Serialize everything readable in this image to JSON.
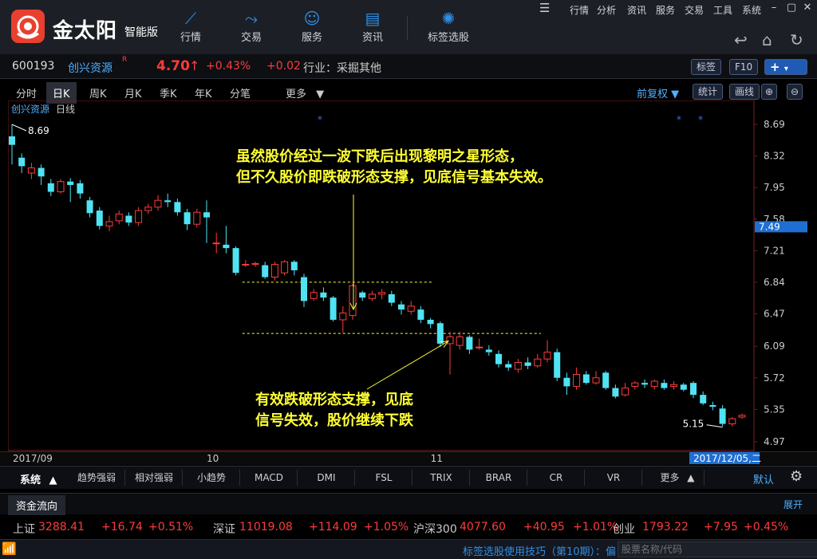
{
  "app": {
    "logo_text": "金太阳",
    "logo_sub": "智能版",
    "nav": [
      {
        "label": "行情",
        "icon": "trend-icon"
      },
      {
        "label": "交易",
        "icon": "trade-icon"
      },
      {
        "label": "服务",
        "icon": "user-icon"
      },
      {
        "label": "资讯",
        "icon": "news-icon"
      },
      {
        "label": "标签选股",
        "icon": "bulb-icon"
      }
    ],
    "menu": [
      "行情",
      "分析",
      "资讯",
      "服务",
      "交易",
      "工具",
      "系统"
    ]
  },
  "quote": {
    "code": "600193",
    "name": "创兴资源",
    "sup": "R",
    "price": "4.70",
    "arrow": "↑",
    "pct": "+0.43%",
    "chg": "+0.02",
    "industry": "行业：采掘其他",
    "btn_tag": "标签",
    "btn_f10": "F10",
    "btn_plus": "+"
  },
  "tabs": {
    "items": [
      "分时",
      "日K",
      "周K",
      "月K",
      "季K",
      "年K",
      "分笔"
    ],
    "active": 1,
    "more": "更多",
    "fq": "前复权",
    "stat": "统计",
    "draw": "画线"
  },
  "chart_data": {
    "type": "candlestick",
    "title": "创兴资源",
    "subtitle": "日线",
    "ylim": [
      4.9,
      8.8
    ],
    "yticks": [
      "8.69",
      "8.32",
      "7.95",
      "7.58",
      "7.21",
      "6.84",
      "6.47",
      "6.09",
      "5.72",
      "5.35",
      "4.97"
    ],
    "current_label": "7.49",
    "high_label": "8.69",
    "low_label": "5.15",
    "x_labels": [
      {
        "text": "2017/09",
        "i": 0
      },
      {
        "text": "10",
        "i": 20
      },
      {
        "text": "11",
        "i": 43
      },
      {
        "text": "2017/12/05,二",
        "i": 70,
        "highlight": true
      }
    ],
    "candles": [
      [
        8.55,
        8.45,
        8.69,
        8.22
      ],
      [
        8.3,
        8.2,
        8.35,
        8.12
      ],
      [
        8.12,
        8.18,
        8.24,
        8.05
      ],
      [
        8.18,
        8.08,
        8.22,
        7.98
      ],
      [
        8.0,
        7.9,
        8.05,
        7.85
      ],
      [
        7.9,
        8.02,
        8.05,
        7.88
      ],
      [
        8.02,
        7.98,
        8.06,
        7.78
      ],
      [
        8.0,
        7.88,
        8.04,
        7.82
      ],
      [
        7.8,
        7.65,
        7.84,
        7.6
      ],
      [
        7.68,
        7.5,
        7.72,
        7.46
      ],
      [
        7.5,
        7.55,
        7.62,
        7.44
      ],
      [
        7.56,
        7.64,
        7.68,
        7.52
      ],
      [
        7.62,
        7.54,
        7.66,
        7.5
      ],
      [
        7.54,
        7.68,
        7.72,
        7.5
      ],
      [
        7.68,
        7.72,
        7.76,
        7.64
      ],
      [
        7.72,
        7.8,
        7.86,
        7.68
      ],
      [
        7.8,
        7.78,
        7.88,
        7.72
      ],
      [
        7.78,
        7.66,
        7.82,
        7.62
      ],
      [
        7.66,
        7.52,
        7.7,
        7.45
      ],
      [
        7.52,
        7.66,
        7.7,
        7.48
      ],
      [
        7.66,
        7.6,
        7.8,
        7.3
      ],
      [
        7.3,
        7.3,
        7.42,
        7.18
      ],
      [
        7.28,
        7.24,
        7.5,
        7.18
      ],
      [
        7.24,
        6.95,
        7.26,
        6.92
      ],
      [
        7.05,
        7.05,
        7.1,
        7.02
      ],
      [
        7.05,
        7.06,
        7.08,
        7.02
      ],
      [
        7.04,
        6.9,
        7.08,
        6.88
      ],
      [
        6.9,
        7.05,
        7.08,
        6.86
      ],
      [
        6.95,
        7.08,
        7.1,
        6.92
      ],
      [
        7.08,
        6.98,
        7.1,
        6.92
      ],
      [
        6.9,
        6.62,
        6.94,
        6.55
      ],
      [
        6.65,
        6.72,
        6.76,
        6.62
      ],
      [
        6.72,
        6.66,
        6.78,
        6.62
      ],
      [
        6.66,
        6.4,
        6.68,
        6.38
      ],
      [
        6.4,
        6.48,
        6.56,
        6.25
      ],
      [
        6.45,
        6.8,
        6.82,
        6.4
      ],
      [
        6.72,
        6.66,
        6.74,
        6.62
      ],
      [
        6.65,
        6.7,
        6.74,
        6.62
      ],
      [
        6.7,
        6.72,
        6.76,
        6.64
      ],
      [
        6.7,
        6.6,
        6.74,
        6.56
      ],
      [
        6.58,
        6.52,
        6.62,
        6.46
      ],
      [
        6.5,
        6.56,
        6.62,
        6.46
      ],
      [
        6.52,
        6.4,
        6.56,
        6.36
      ],
      [
        6.4,
        6.35,
        6.42,
        6.3
      ],
      [
        6.36,
        6.12,
        6.38,
        6.08
      ],
      [
        6.12,
        6.2,
        6.26,
        5.76
      ],
      [
        6.1,
        6.2,
        6.26,
        6.05
      ],
      [
        6.2,
        6.05,
        6.22,
        6.0
      ],
      [
        6.08,
        6.08,
        6.18,
        6.05
      ],
      [
        6.05,
        6.02,
        6.1,
        5.98
      ],
      [
        6.0,
        5.88,
        6.04,
        5.84
      ],
      [
        5.88,
        5.84,
        5.92,
        5.8
      ],
      [
        5.82,
        5.9,
        5.94,
        5.78
      ],
      [
        5.9,
        5.86,
        5.96,
        5.82
      ],
      [
        5.86,
        5.94,
        6.0,
        5.84
      ],
      [
        5.94,
        6.02,
        6.16,
        5.9
      ],
      [
        6.02,
        5.72,
        6.06,
        5.68
      ],
      [
        5.72,
        5.62,
        5.78,
        5.52
      ],
      [
        5.62,
        5.76,
        5.84,
        5.58
      ],
      [
        5.76,
        5.66,
        5.8,
        5.64
      ],
      [
        5.66,
        5.72,
        5.8,
        5.64
      ],
      [
        5.78,
        5.6,
        5.8,
        5.58
      ],
      [
        5.6,
        5.5,
        5.64,
        5.48
      ],
      [
        5.52,
        5.6,
        5.66,
        5.5
      ],
      [
        5.62,
        5.66,
        5.68,
        5.58
      ],
      [
        5.66,
        5.64,
        5.7,
        5.6
      ],
      [
        5.62,
        5.68,
        5.7,
        5.58
      ],
      [
        5.66,
        5.6,
        5.7,
        5.58
      ],
      [
        5.62,
        5.64,
        5.68,
        5.58
      ],
      [
        5.64,
        5.58,
        5.66,
        5.56
      ],
      [
        5.66,
        5.52,
        5.68,
        5.48
      ],
      [
        5.52,
        5.42,
        5.56,
        5.4
      ],
      [
        5.4,
        5.38,
        5.44,
        5.34
      ],
      [
        5.36,
        5.18,
        5.4,
        5.15
      ],
      [
        5.18,
        5.24,
        5.26,
        5.15
      ],
      [
        5.26,
        5.28,
        5.3,
        5.24
      ]
    ],
    "guides": [
      {
        "y": 6.84,
        "i0": 24,
        "i1": 43
      },
      {
        "y": 6.24,
        "i0": 24,
        "i1": 54
      }
    ],
    "annotations": [
      {
        "lines": [
          "虽然股价经过一波下跌后出现黎明之星形态，",
          "但不久股价即跌破形态支撑，见底信号基本失效。"
        ]
      },
      {
        "lines": [
          "有效跌破形态支撑，见底",
          "信号失效，股价继续下跌"
        ]
      }
    ]
  },
  "indicators": {
    "system": "系统",
    "items": [
      "趋势强弱",
      "相对强弱",
      "小趋势",
      "MACD",
      "DMI",
      "FSL",
      "TRIX",
      "BRAR",
      "CR",
      "VR",
      "更多"
    ],
    "default": "默认"
  },
  "flow": {
    "label": "资金流向",
    "expand": "展开"
  },
  "indices": [
    {
      "name": "上证",
      "value": "3288.41",
      "chg": "+16.74",
      "pct": "+0.51%"
    },
    {
      "name": "深证",
      "value": "11019.08",
      "chg": "+114.09",
      "pct": "+1.05%"
    },
    {
      "name": "沪深300",
      "value": "4077.60",
      "chg": "+40.95",
      "pct": "+1.01%"
    },
    {
      "name": "创业",
      "value": "1793.22",
      "chg": "+7.95",
      "pct": "+0.45%"
    }
  ],
  "bottom": {
    "tip": "标签选股使用技巧（第10期）：偏",
    "search_placeholder": "股票名称/代码"
  },
  "colors": {
    "up": "#ff3b3b",
    "down": "#4fe3f4",
    "accent": "#2f8fe6",
    "note": "#ffff33"
  }
}
